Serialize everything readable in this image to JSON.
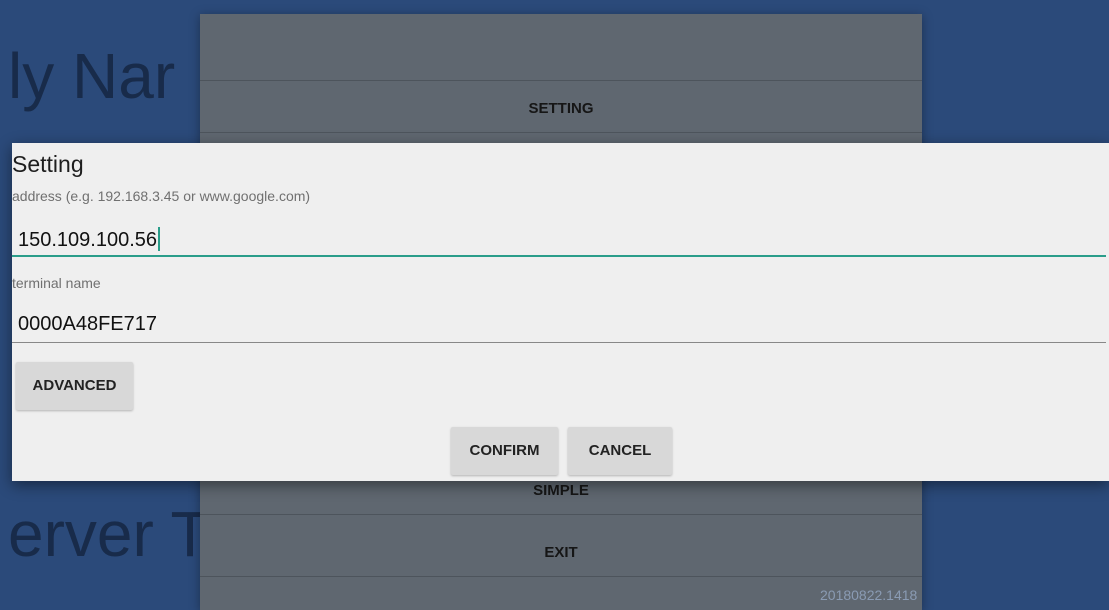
{
  "background": {
    "lines": [
      "ly Nar",
      "erver T",
      "20180822.1418"
    ],
    "menu": {
      "setting_label": "SETTING",
      "simple_label": "SIMPLE",
      "exit_label": "EXIT"
    }
  },
  "dialog": {
    "title": "Setting",
    "address": {
      "label": "address (e.g. 192.168.3.45 or www.google.com)",
      "value": "150.109.100.56"
    },
    "terminal": {
      "label": "terminal name",
      "value": "0000A48FE717"
    },
    "advanced_label": "ADVANCED",
    "confirm_label": "CONFIRM",
    "cancel_label": "CANCEL"
  },
  "colors": {
    "background": "#2b4a7a",
    "menu": "#5f6770",
    "dialog": "#efefef",
    "accent": "#2a9d8a"
  }
}
